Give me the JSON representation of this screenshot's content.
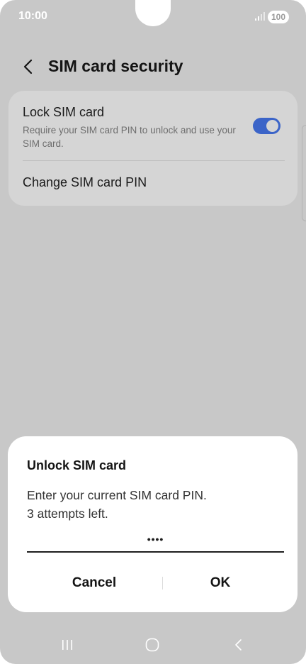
{
  "status_bar": {
    "time": "10:00",
    "battery": "100",
    "icons": [
      "signal-icon",
      "battery-icon"
    ]
  },
  "header": {
    "title": "SIM card security",
    "back_icon": "chevron-left-icon"
  },
  "settings": {
    "lock_sim": {
      "title": "Lock SIM card",
      "description": "Require your SIM card PIN to unlock and use your SIM card.",
      "toggle_on": true
    },
    "change_pin": {
      "title": "Change SIM card PIN"
    }
  },
  "dialog": {
    "title": "Unlock SIM card",
    "message_line1": "Enter your current SIM card PIN.",
    "message_line2": "3 attempts left.",
    "pin_value": "••••",
    "cancel_label": "Cancel",
    "ok_label": "OK"
  },
  "nav_bar": {
    "icons": [
      "recents-icon",
      "home-icon",
      "back-icon"
    ]
  },
  "colors": {
    "background_dim": "#c8c8c8",
    "card": "#d5d5d5",
    "toggle_accent": "#3b64c8",
    "dialog": "#ffffff"
  }
}
